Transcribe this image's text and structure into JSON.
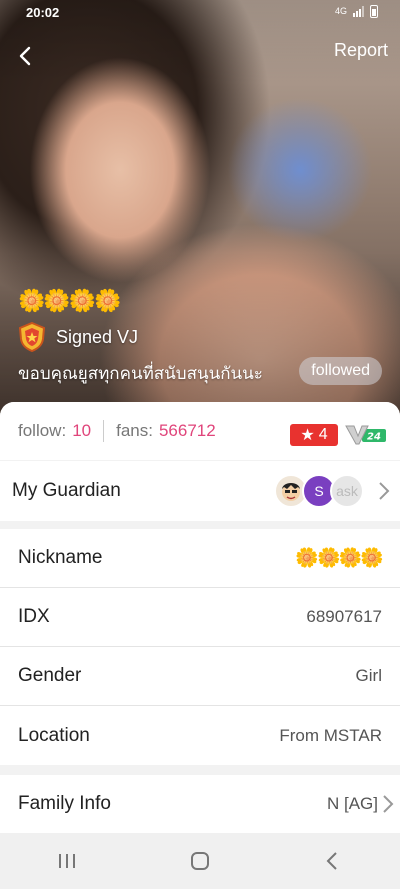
{
  "status_bar": {
    "time": "20:02",
    "network": "4G"
  },
  "header": {
    "report_label": "Report"
  },
  "profile": {
    "flowers": "🌼🌼🌼🌼",
    "signed_label": "Signed VJ",
    "bio": "ขอบคุณยูสทุกคนที่สนับสนุนกันนะ",
    "followed_label": "followed"
  },
  "stats": {
    "follow_label": "follow:",
    "follow_value": "10",
    "fans_label": "fans:",
    "fans_value": "566712",
    "level": "4",
    "vip_level": "24"
  },
  "guardian": {
    "label": "My Guardian",
    "avatars": [
      "",
      "S",
      "ask"
    ]
  },
  "info": {
    "nickname_label": "Nickname",
    "nickname_value": "🌼🌼🌼🌼",
    "idx_label": "IDX",
    "idx_value": "68907617",
    "gender_label": "Gender",
    "gender_value": "Girl",
    "location_label": "Location",
    "location_value": "From MSTAR"
  },
  "family": {
    "label": "Family Info",
    "value": "N [AG]"
  },
  "colors": {
    "accent_pink": "#e0457b",
    "level_red": "#e8322f",
    "vip_green": "#2fb86a"
  }
}
